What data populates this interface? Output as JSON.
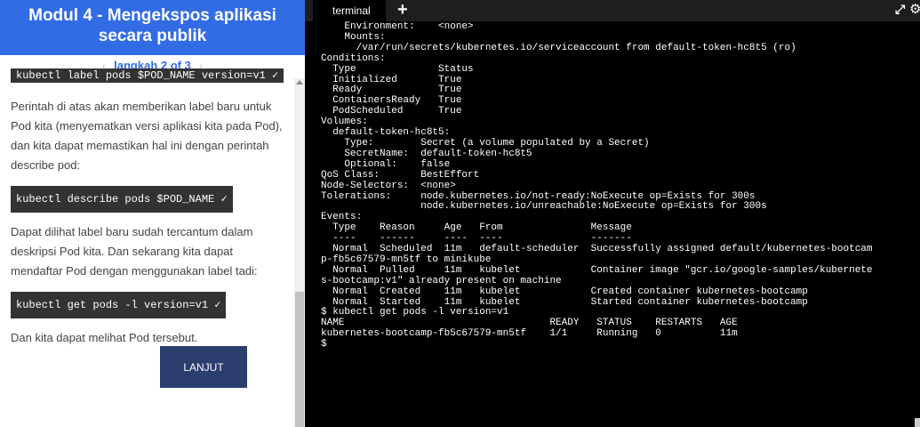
{
  "tutorial": {
    "title": "Modul 4 - Mengekspos aplikasi secara publik",
    "step_label": "langkah 2 of 3",
    "prev_arrow": "‹",
    "next_arrow": "›",
    "truncated_cmd": "kubectl label pods $POD_NAME version=v1 ✓",
    "para1": "Perintah di atas akan memberikan label baru untuk Pod kita (menyematkan versi aplikasi kita pada Pod), dan kita dapat memastikan hal ini dengan perintah describe pod:",
    "cmd1": "kubectl describe pods $POD_NAME ✓",
    "para2": "Dapat dilihat label baru sudah tercantum dalam deskripsi Pod kita. Dan sekarang kita dapat mendaftar Pod dengan menggunakan label tadi:",
    "cmd2": "kubectl get pods -l version=v1 ✓",
    "para3": "Dan kita dapat melihat Pod tersebut.",
    "next_button": "LANJUT"
  },
  "terminal": {
    "tab_label": "terminal",
    "new_tab": "+",
    "expand_icon": "⤢",
    "settings_icon": "⚙",
    "output": "    Environment:    <none>\n    Mounts:\n      /var/run/secrets/kubernetes.io/serviceaccount from default-token-hc8t5 (ro)\nConditions:\n  Type              Status\n  Initialized       True\n  Ready             True\n  ContainersReady   True\n  PodScheduled      True\nVolumes:\n  default-token-hc8t5:\n    Type:        Secret (a volume populated by a Secret)\n    SecretName:  default-token-hc8t5\n    Optional:    false\nQoS Class:       BestEffort\nNode-Selectors:  <none>\nTolerations:     node.kubernetes.io/not-ready:NoExecute op=Exists for 300s\n                 node.kubernetes.io/unreachable:NoExecute op=Exists for 300s\nEvents:\n  Type    Reason     Age   From               Message\n  ----    ------     ----  ----               -------\n  Normal  Scheduled  11m   default-scheduler  Successfully assigned default/kubernetes-bootcam\np-fb5c67579-mn5tf to minikube\n  Normal  Pulled     11m   kubelet            Container image \"gcr.io/google-samples/kubernete\ns-bootcamp:v1\" already present on machine\n  Normal  Created    11m   kubelet            Created container kubernetes-bootcamp\n  Normal  Started    11m   kubelet            Started container kubernetes-bootcamp\n$ kubectl get pods -l version=v1\nNAME                                   READY   STATUS    RESTARTS   AGE\nkubernetes-bootcamp-fb5c67579-mn5tf    1/1     Running   0          11m\n$"
  }
}
